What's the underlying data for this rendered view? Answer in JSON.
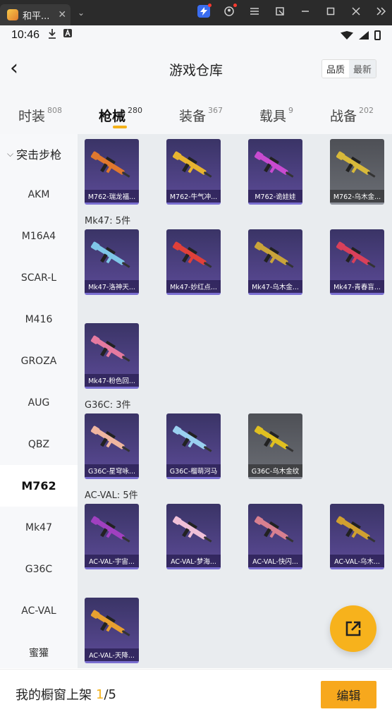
{
  "window": {
    "tab_title": "和平...",
    "tab_close": "✕",
    "tab_dropdown": "⌄",
    "icons": [
      "lightning-icon",
      "account-icon",
      "menu-icon",
      "screenshot-icon",
      "minimize-icon",
      "maximize-icon",
      "close-icon",
      "double-chevron-icon"
    ]
  },
  "status": {
    "time": "10:46"
  },
  "header": {
    "back": "‹",
    "title": "游戏仓库",
    "sort_options": [
      "品质",
      "最新"
    ]
  },
  "category_tabs": [
    {
      "label": "时装",
      "count": "808"
    },
    {
      "label": "枪械",
      "count": "280",
      "active": true
    },
    {
      "label": "装备",
      "count": "367"
    },
    {
      "label": "载具",
      "count": "9"
    },
    {
      "label": "战备",
      "count": "202"
    }
  ],
  "sidebar": {
    "heading": "突击步枪",
    "items": [
      "AKM",
      "M16A4",
      "SCAR-L",
      "M416",
      "GROZA",
      "AUG",
      "QBZ",
      "M762",
      "Mk47",
      "G36C",
      "AC-VAL",
      "蜜獾"
    ],
    "active": "M762"
  },
  "groups": [
    {
      "label": "",
      "items": [
        {
          "name": "M762-瑞龙福...",
          "style": "purple",
          "color": "#e0782e"
        },
        {
          "name": "M762-牛气冲...",
          "style": "purple",
          "color": "#e8b430"
        },
        {
          "name": "M762-诡娃娃",
          "style": "purple",
          "color": "#c84bd0"
        },
        {
          "name": "M762-乌木金...",
          "style": "grey",
          "color": "#d8b93a"
        }
      ]
    },
    {
      "label": "Mk47: 5件",
      "items": [
        {
          "name": "Mk47-洛神天...",
          "style": "purple",
          "color": "#7fc7e8"
        },
        {
          "name": "Mk47-妙红点...",
          "style": "purple",
          "color": "#e0403a"
        },
        {
          "name": "Mk47-乌木金...",
          "style": "purple",
          "color": "#c9a43a"
        },
        {
          "name": "Mk47-青春盲...",
          "style": "purple",
          "color": "#d8405a"
        },
        {
          "name": "Mk47-粉色回...",
          "style": "purple",
          "color": "#e57aa0"
        }
      ]
    },
    {
      "label": "G36C: 3件",
      "items": [
        {
          "name": "G36C-星穹咏...",
          "style": "purple",
          "color": "#f0b6a0"
        },
        {
          "name": "G36C-榴萌河马",
          "style": "purple",
          "color": "#9ad0f0"
        },
        {
          "name": "G36C-乌木金纹",
          "style": "grey",
          "color": "#e0c020"
        }
      ]
    },
    {
      "label": "AC-VAL: 5件",
      "items": [
        {
          "name": "AC-VAL-宇宙...",
          "style": "purple",
          "color": "#a040c0"
        },
        {
          "name": "AC-VAL-梦海...",
          "style": "purple",
          "color": "#f0c0d8"
        },
        {
          "name": "AC-VAL-快闪...",
          "style": "purple",
          "color": "#d88090"
        },
        {
          "name": "AC-VAL-乌木...",
          "style": "purple",
          "color": "#d0a030"
        },
        {
          "name": "AC-VAL-天降...",
          "style": "purple",
          "color": "#e8a030"
        }
      ]
    }
  ],
  "footer": {
    "label": "我的橱窗上架",
    "current": "1",
    "total": "/5",
    "edit": "编辑"
  }
}
